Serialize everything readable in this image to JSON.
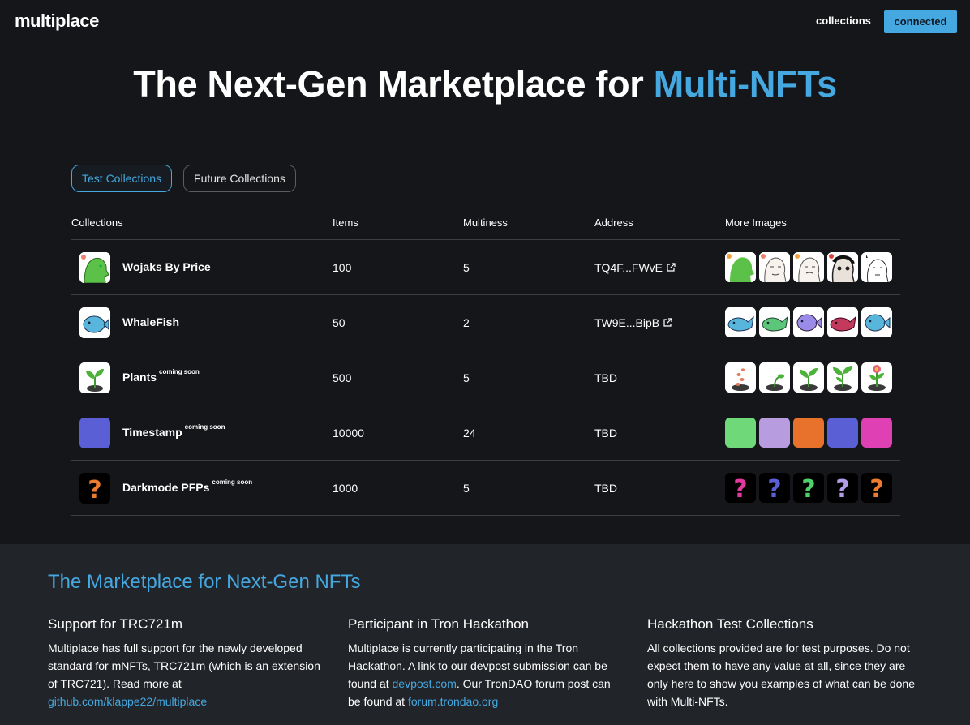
{
  "header": {
    "logo": "multiplace",
    "nav_collections": "collections",
    "connect_label": "connected"
  },
  "hero": {
    "title_main": "The Next-Gen Marketplace for ",
    "title_accent": "Multi-NFTs"
  },
  "tabs": [
    {
      "label": "Test Collections",
      "active": true
    },
    {
      "label": "Future Collections",
      "active": false
    }
  ],
  "table": {
    "headers": [
      "Collections",
      "Items",
      "Multiness",
      "Address",
      "More Images"
    ],
    "rows": [
      {
        "name": "Wojaks By Price",
        "badge": "",
        "items": "100",
        "multiness": "5",
        "address": "TQ4F...FWvE",
        "icon": "wojak-icon",
        "images": [
          "wojak-green-icon",
          "wojak-sketch-icon",
          "wojak-sketch-icon",
          "wojak-dark-icon",
          "wojak-sketch-icon"
        ]
      },
      {
        "name": "WhaleFish",
        "badge": "",
        "items": "50",
        "multiness": "2",
        "address": "TW9E...BipB",
        "icon": "whalefish-icon",
        "images": [
          "whale-blue-icon",
          "whale-green-icon",
          "fish-purple-icon",
          "whale-red-icon",
          "fish-blue-icon"
        ]
      },
      {
        "name": "Plants",
        "badge": "coming soon",
        "items": "500",
        "multiness": "5",
        "address": "TBD",
        "icon": "sprout-icon",
        "images": [
          "seed-icon",
          "seedling-icon",
          "sprout-icon",
          "sprout-icon",
          "flower-icon"
        ]
      },
      {
        "name": "Timestamp",
        "badge": "coming soon",
        "items": "10000",
        "multiness": "24",
        "address": "TBD",
        "icon": "color-square-icon",
        "images": [
          "green-square",
          "lavender-square",
          "orange-square",
          "indigo-square",
          "magenta-square"
        ]
      },
      {
        "name": "Darkmode PFPs",
        "badge": "coming soon",
        "items": "1000",
        "multiness": "5",
        "address": "TBD",
        "icon": "question-mark-icon",
        "images": [
          "pink-question-icon",
          "indigo-question-icon",
          "green-question-icon",
          "purple-question-icon",
          "orange-question-icon"
        ]
      }
    ]
  },
  "colors": {
    "accent": "#45a8e0",
    "background": "#141619",
    "footer_bg": "#212429",
    "timestamp_swatches": [
      "#6fd879",
      "#b89ce0",
      "#e8712b",
      "#5b5fd6",
      "#df41b4"
    ],
    "question_colors": [
      "#e2399f",
      "#5b5fd6",
      "#4fd06a",
      "#b19de6",
      "#ee7a2e"
    ],
    "timestamp_icon": "#5b5fd6",
    "darkmode_icon": "#ee7a2e"
  },
  "footer": {
    "title": "The Marketplace for Next-Gen NFTs",
    "col1": {
      "heading": "Support for TRC721m",
      "text": "Multiplace has full support for the newly developed standard for mNFTs, TRC721m (which is an extension of TRC721). Read more at ",
      "link": "github.com/klappe22/multiplace"
    },
    "col2": {
      "heading": "Participant in Tron Hackathon",
      "text1": "Multiplace is currently participating in the Tron Hackathon. A link to our devpost submission can be found at ",
      "link1": "devpost.com",
      "text2": ". Our TronDAO forum post can be found at ",
      "link2": "forum.trondao.org"
    },
    "col3": {
      "heading": "Hackathon Test Collections",
      "text": "All collections provided are for test purposes. Do not expect them to have any value at all, since they are only here to show you examples of what can be done with Multi-NFTs."
    }
  }
}
